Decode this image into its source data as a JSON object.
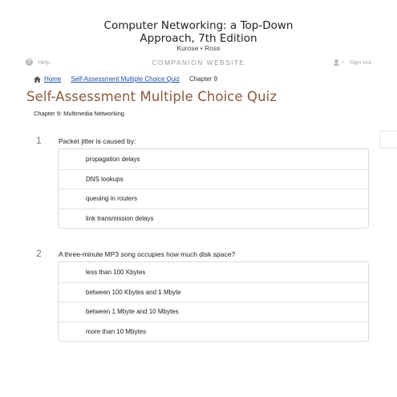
{
  "header": {
    "book_title_line1": "Computer Networking: a Top-Down",
    "book_title_line2": "Approach, 7th Edition",
    "authors": "Kurose • Ross"
  },
  "topbar": {
    "help_label": "Help",
    "site_label": "COMPANION WEBSITE",
    "signout_label": "Sign out"
  },
  "breadcrumb": {
    "home": "Home",
    "quiz": "Self-Assessment Multiple Choice Quiz",
    "chapter": "Chapter 9"
  },
  "page": {
    "title": "Self-Assessment Multiple Choice Quiz",
    "subtitle": "Chapter 9: Multimedia Networking"
  },
  "questions": [
    {
      "number": "1",
      "text": "Packet jitter is caused by:",
      "options": [
        "propagation delays",
        "DNS lookups",
        "queuing in routers",
        "link transmission delays"
      ]
    },
    {
      "number": "2",
      "text": "A three-minute MP3 song occupies how much disk space?",
      "options": [
        "less than 100 Kbytes",
        "between 100 Kbytes and 1 Mbyte",
        "between 1 Mbyte and 10 Mbytes",
        "more than 10 Mbytes"
      ]
    }
  ],
  "icons": {
    "help": "help-circle-icon",
    "signout": "user-x-icon",
    "home": "home-icon"
  },
  "colors": {
    "title_brown": "#8a5a3c",
    "link_blue": "#1f4fa3"
  }
}
